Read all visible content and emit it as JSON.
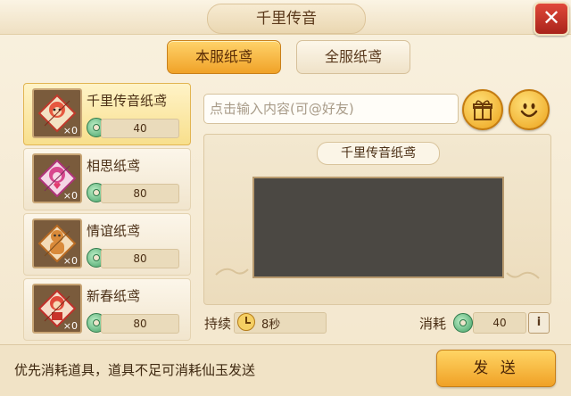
{
  "dialog": {
    "title": "千里传音"
  },
  "tabs": [
    {
      "label": "本服纸鸢",
      "active": true
    },
    {
      "label": "全服纸鸢",
      "active": false
    }
  ],
  "kites": [
    {
      "name": "千里传音纸鸢",
      "count": "×0",
      "cost": "40",
      "selected": true,
      "icon": "monkey-kite-icon"
    },
    {
      "name": "相思纸鸢",
      "count": "×0",
      "cost": "80",
      "selected": false,
      "icon": "heart-kite-icon"
    },
    {
      "name": "情谊纸鸢",
      "count": "×0",
      "cost": "80",
      "selected": false,
      "icon": "gingerbread-kite-icon"
    },
    {
      "name": "新春纸鸢",
      "count": "×0",
      "cost": "80",
      "selected": false,
      "icon": "newyear-kite-icon"
    }
  ],
  "message": {
    "placeholder": "点击输入内容(可@好友)",
    "value": ""
  },
  "preview": {
    "label": "千里传音纸鸢"
  },
  "duration": {
    "label": "持续",
    "value": "8秒"
  },
  "cost": {
    "label": "消耗",
    "value": "40"
  },
  "footer": {
    "notice": "优先消耗道具，道具不足可消耗仙玉发送",
    "send_label": "发 送"
  },
  "colors": {
    "accent": "#f0a228",
    "close": "#c8332a",
    "screen": "#4b4843"
  }
}
